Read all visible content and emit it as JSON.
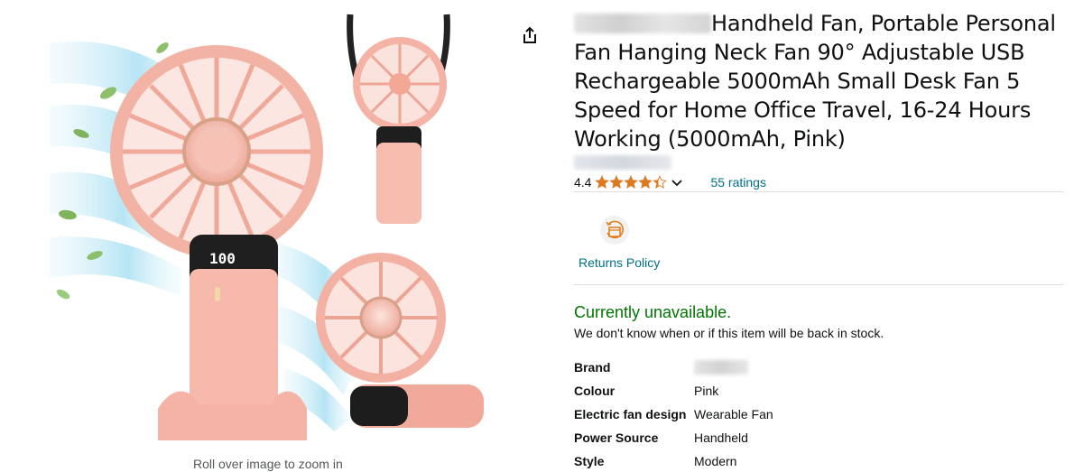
{
  "product": {
    "title": "Handheld Fan, Portable Personal Fan Hanging Neck Fan 90° Adjustable USB Rechargeable 5000mAh Small Desk Fan 5 Speed for Home Office Travel, 16-24 Hours Working (5000mAh, Pink)",
    "image_alt": "Pink handheld fan with digital display",
    "display_readout": "100"
  },
  "image_area": {
    "zoom_hint": "Roll over image to zoom in"
  },
  "icons": {
    "share": "share-icon",
    "returns": "returns-policy-icon",
    "star": "star-icon",
    "chevron": "chevron-down-icon"
  },
  "rating": {
    "value": "4.4",
    "stars": 4.4,
    "count_label": "55 ratings"
  },
  "returns": {
    "label": "Returns Policy"
  },
  "availability": {
    "status": "Currently unavailable.",
    "note": "We don't know when or if this item will be back in stock."
  },
  "specs": [
    {
      "label": "Brand",
      "value": ""
    },
    {
      "label": "Colour",
      "value": "Pink"
    },
    {
      "label": "Electric fan design",
      "value": "Wearable Fan"
    },
    {
      "label": "Power Source",
      "value": "Handheld"
    },
    {
      "label": "Style",
      "value": "Modern"
    }
  ],
  "colors": {
    "link": "#007185",
    "available_green": "#007600",
    "star_orange": "#de7921",
    "fan_pink": "#f5b8ac"
  }
}
